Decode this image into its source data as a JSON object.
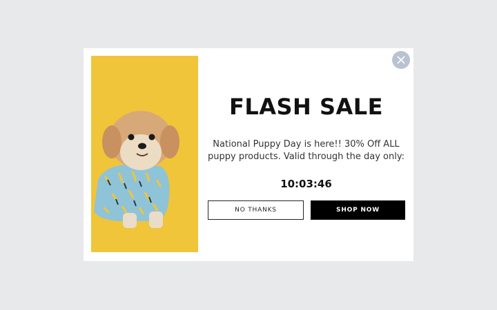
{
  "popup": {
    "title": "FLASH SALE",
    "message": "National Puppy Day is here!! 30% Off ALL puppy products. Valid through the day only:",
    "countdown": "10:03:46",
    "decline_label": "NO THANKS",
    "accept_label": "SHOP NOW",
    "close_icon": "close-icon",
    "image": "dog-photo"
  },
  "colors": {
    "overlay": "#e8e9eb",
    "photo_background": "#f0c53a",
    "accept_button": "#000000",
    "close_button": "#b9c2d0"
  }
}
